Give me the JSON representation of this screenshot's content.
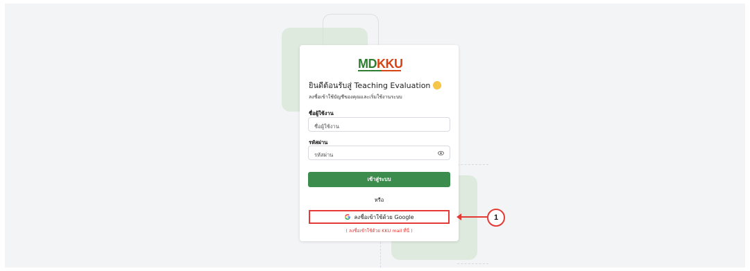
{
  "logo": {
    "md": "MD",
    "kku": "KKU"
  },
  "login": {
    "welcome": "ยินดีต้อนรับสู่ Teaching Evaluation",
    "subtitle": "ลงชื่อเข้าใช้บัญชีของคุณและเริ่มใช้งานระบบ",
    "username_label": "ชื่อผู้ใช้งาน",
    "username_placeholder": "ชื่อผู้ใช้งาน",
    "username_value": "",
    "password_label": "รหัสผ่าน",
    "password_placeholder": "รหัสผ่าน",
    "password_value": "",
    "login_button": "เข้าสู่ระบบ",
    "or_text": "หรือ",
    "google_button": "ลงชื่อเข้าใช้ด้วย Google",
    "kku_note": "( ลงชื่อเข้าใช้ด้วย KKU mail ที่นี่ )"
  },
  "annotation": {
    "callout_number": "1"
  },
  "icons": {
    "wave": "waving-hand-icon",
    "eye": "eye-icon",
    "google": "google-icon"
  },
  "colors": {
    "brand_green": "#3c8c4d",
    "brand_orange": "#d84315",
    "highlight_red": "#e53935"
  }
}
